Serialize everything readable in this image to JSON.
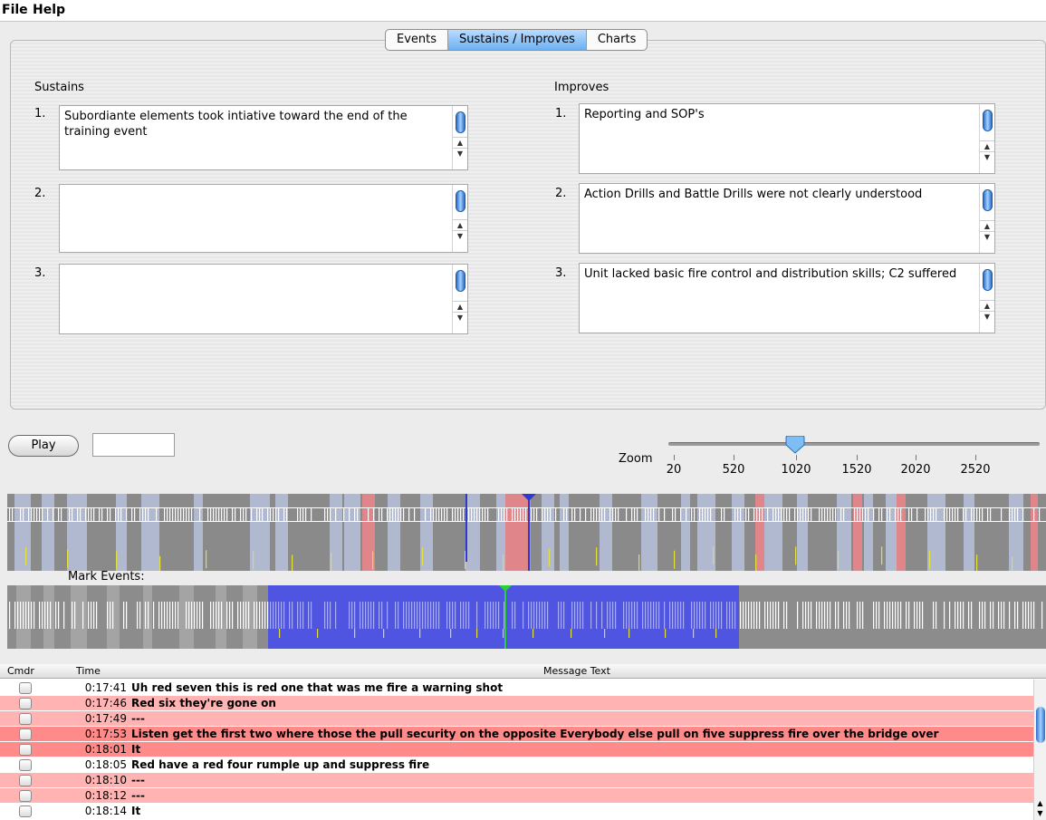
{
  "menu": [
    "File",
    "Help"
  ],
  "tabs": [
    {
      "label": "Events",
      "active": false
    },
    {
      "label": "Sustains / Improves",
      "active": true
    },
    {
      "label": "Charts",
      "active": false
    }
  ],
  "sustains": {
    "heading": "Sustains",
    "items": [
      {
        "num": "1.",
        "text": "Subordiante elements took intiative toward the end of the training event"
      },
      {
        "num": "2.",
        "text": ""
      },
      {
        "num": "3.",
        "text": ""
      }
    ]
  },
  "improves": {
    "heading": "Improves",
    "items": [
      {
        "num": "1.",
        "text": "Reporting and SOP's"
      },
      {
        "num": "2.",
        "text": "Action Drills and Battle Drills were not clearly understood"
      },
      {
        "num": "3.",
        "text": "Unit lacked basic fire control and distribution skills; C2 suffered"
      }
    ]
  },
  "controls": {
    "play_label": "Play",
    "time_value": "",
    "zoom_label": "Zoom",
    "zoom_ticks": [
      "20",
      "520",
      "1020",
      "1520",
      "2020",
      "2520"
    ],
    "zoom_value": 1020
  },
  "mark_events_label": "Mark Events:",
  "colors": {
    "tab_active": "#6eb0f2",
    "row_pink": "#ffb3b3",
    "row_red": "#ff8a8a",
    "event_blue": "#4f55e0",
    "timeline_red": "#e0858a",
    "timeline_light": "#b0b9d0"
  },
  "table": {
    "headers": {
      "cmdr": "Cmdr",
      "time": "Time",
      "msg": "Message Text"
    },
    "rows": [
      {
        "time": "0:17:41",
        "msg": "Uh red seven this is red one that was me fire a warning shot",
        "color": "#ffffff"
      },
      {
        "time": "0:17:46",
        "msg": "Red six they're gone on",
        "color": "#ffb3b3"
      },
      {
        "time": "0:17:49",
        "msg": "---",
        "color": "#ffb3b3"
      },
      {
        "time": "0:17:53",
        "msg": "Listen get the first two where those the pull security on the opposite Everybody else pull on five suppress fire over the bridge over",
        "color": "#ff8a8a"
      },
      {
        "time": "0:18:01",
        "msg": "It",
        "color": "#ff8a8a"
      },
      {
        "time": "0:18:05",
        "msg": "Red have a red four rumple up and suppress fire",
        "color": "#ffffff"
      },
      {
        "time": "0:18:10",
        "msg": "---",
        "color": "#ffb3b3"
      },
      {
        "time": "0:18:12",
        "msg": "---",
        "color": "#ffb3b3"
      },
      {
        "time": "0:18:14",
        "msg": "It",
        "color": "#ffffff"
      }
    ]
  }
}
